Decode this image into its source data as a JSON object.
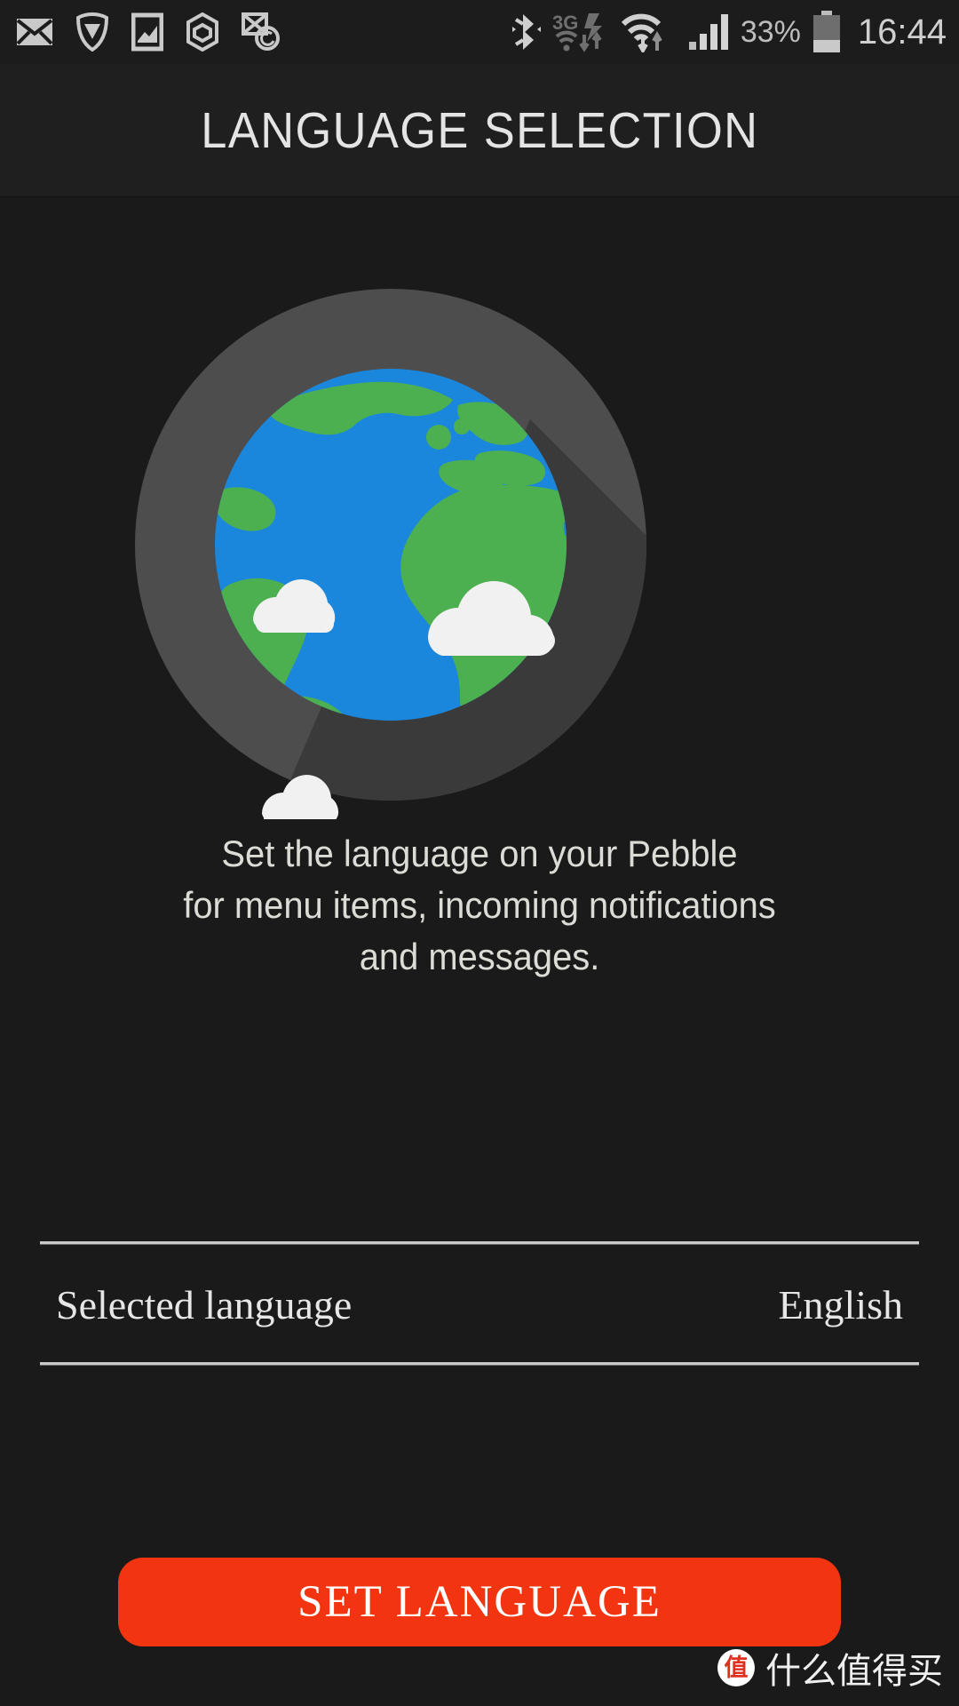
{
  "statusbar": {
    "left_icons": [
      {
        "name": "envelope-icon",
        "label": "Email"
      },
      {
        "name": "shield-icon",
        "label": "Security"
      },
      {
        "name": "gallery-icon",
        "label": "Gallery"
      },
      {
        "name": "hexagon-icon",
        "label": "App"
      },
      {
        "name": "email-sync-icon",
        "label": "Mail sync"
      }
    ],
    "right_icons": [
      {
        "name": "bluetooth-icon",
        "label": "Bluetooth"
      },
      {
        "name": "mobile-data-3g-icon",
        "label": "3G"
      },
      {
        "name": "wifi-icon",
        "label": "Wi-Fi"
      },
      {
        "name": "cellular-signal-icon",
        "label": "Signal"
      }
    ],
    "mobile_data_label": "3G",
    "battery_percent": "33%",
    "battery_level": 33,
    "clock": "16:44"
  },
  "header": {
    "title": "LANGUAGE SELECTION"
  },
  "hero": {
    "illustration_name": "globe-earth-illustration",
    "colors": {
      "backdrop": "#4d4d4d",
      "backdrop_shadow": "#3a3a3a",
      "ocean": "#1b87dc",
      "land": "#4cb050",
      "cloud": "#f1f1f1",
      "page_background": "#1a1a1a"
    }
  },
  "description": {
    "lines": [
      "Set the language on your Pebble",
      "for menu items, incoming notifications",
      "and messages."
    ]
  },
  "language_row": {
    "label": "Selected language",
    "value": "English"
  },
  "button": {
    "label": "SET LANGUAGE",
    "color": "#f23411",
    "text_color": "#ffffff"
  },
  "watermark": {
    "logo_char": "值",
    "text": "什么值得买"
  }
}
